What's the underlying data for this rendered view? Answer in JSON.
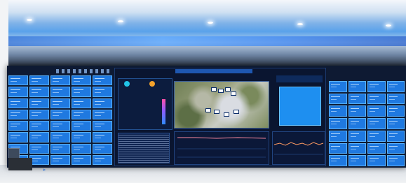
{
  "scene": {
    "description_type": "photo-of-control-room-video-wall",
    "colors": {
      "tile_fill": "#1f79e0",
      "tile_border": "#58b2ff",
      "dashboard_bg": "#0a1530",
      "accent_cyan": "#21c4e8",
      "accent_orange": "#f4a22b"
    },
    "left_wall_grid": {
      "columns": 5,
      "rows": 8
    },
    "right_wall_grid": {
      "columns": 4,
      "rows": 7
    },
    "map_marker_count": 8
  }
}
